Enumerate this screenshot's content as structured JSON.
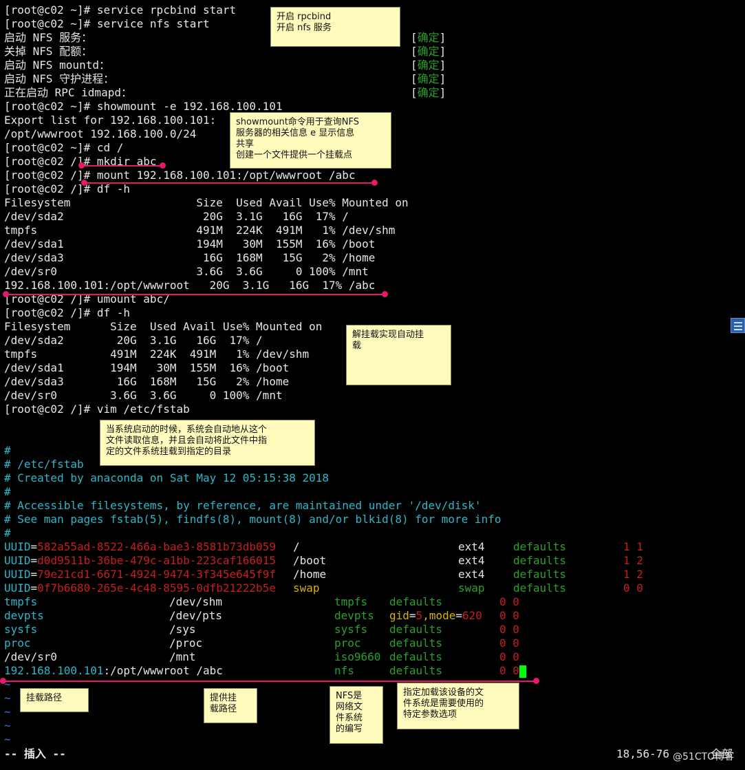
{
  "terminal": {
    "prompt_home": "[root@c02 ~]# ",
    "prompt_root": "[root@c02 /]# ",
    "cmd_rpcbind": "service rpcbind start",
    "cmd_nfs": "service nfs start",
    "svc": [
      {
        "label": "启动 NFS 服务：",
        "status": "确定"
      },
      {
        "label": "关掉 NFS 配额：",
        "status": "确定"
      },
      {
        "label": "启动 NFS mountd：",
        "status": "确定"
      },
      {
        "label": "启动 NFS 守护进程：",
        "status": "确定"
      },
      {
        "label": "正在启动 RPC idmapd：",
        "status": "确定"
      }
    ],
    "cmd_showmount": "showmount -e 192.168.100.101",
    "export_list": "Export list for 192.168.100.101:",
    "export_entry": "/opt/wwwroot 192.168.100.0/24",
    "cmd_cd": "cd /",
    "cmd_mkdir": "mkdir abc",
    "cmd_mount": "mount 192.168.100.101:/opt/wwwroot /abc",
    "cmd_df": "df -h",
    "df1": [
      "Filesystem                   Size  Used Avail Use% Mounted on",
      "/dev/sda2                     20G  3.1G   16G  17% /",
      "tmpfs                        491M  224K  491M   1% /dev/shm",
      "/dev/sda1                    194M   30M  155M  16% /boot",
      "/dev/sda3                     16G  168M   15G   2% /home",
      "/dev/sr0                     3.6G  3.6G     0 100% /mnt",
      "192.168.100.101:/opt/wwwroot   20G  3.1G   16G  17% /abc"
    ],
    "cmd_umount": "umount abc/",
    "df2": [
      "Filesystem      Size  Used Avail Use% Mounted on",
      "/dev/sda2        20G  3.1G   16G  17% /",
      "tmpfs           491M  224K  491M   1% /dev/shm",
      "/dev/sda1       194M   30M  155M  16% /boot",
      "/dev/sda3        16G  168M   15G   2% /home",
      "/dev/sr0        3.6G  3.6G     0 100% /mnt"
    ],
    "cmd_vim": "vim /etc/fstab",
    "fstab_comments": [
      "#",
      "# /etc/fstab",
      "# Created by anaconda on Sat May 12 05:15:38 2018",
      "#",
      "# Accessible filesystems, by reference, are maintained under '/dev/disk'",
      "# See man pages fstab(5), findfs(8), mount(8) and/or blkid(8) for more info",
      "#"
    ],
    "uuid_rows": [
      {
        "key": "UUID",
        "val": "582a55ad-8522-466a-bae3-8581b73db059",
        "mnt": "/",
        "fs": "ext4",
        "opt": "defaults",
        "nums": "1 1"
      },
      {
        "key": "UUID",
        "val": "d0d9511b-36be-479c-a1bb-223caf166015",
        "mnt": "/boot",
        "fs": "ext4",
        "opt": "defaults",
        "nums": "1 2"
      },
      {
        "key": "UUID",
        "val": "79e21cd1-6671-4924-9474-3f345e645f9f",
        "mnt": "/home",
        "fs": "ext4",
        "opt": "defaults",
        "nums": "1 2"
      },
      {
        "key": "UUID",
        "val": "0f7b6680-265e-4c48-8595-0dfb21222b5e",
        "mnt": "swap",
        "fs": "swap",
        "opt": "defaults",
        "nums": "0 0"
      }
    ],
    "dev_rows": [
      {
        "dev": "tmpfs",
        "mnt": "/dev/shm",
        "fs": "tmpfs",
        "opt": "defaults",
        "nums": "0 0"
      },
      {
        "dev": "devpts",
        "mnt": "/dev/pts",
        "fs": "devpts",
        "opt_a": "gid",
        "opt_b": "5",
        "opt_c": ",mode",
        "opt_d": "620",
        "nums": "0 0"
      },
      {
        "dev": "sysfs",
        "mnt": "/sys",
        "fs": "sysfs",
        "opt": "defaults",
        "nums": "0 0"
      },
      {
        "dev": "proc",
        "mnt": "/proc",
        "fs": "proc",
        "opt": "defaults",
        "nums": "0 0"
      },
      {
        "dev": "/dev/sr0",
        "mnt": "/mnt",
        "fs": "iso9660",
        "opt": "defaults",
        "nums": "0 0"
      }
    ],
    "nfs_row": {
      "ip": "192.168.100.101",
      "path": ":/opt/wwwroot /abc",
      "fs": "nfs",
      "opt": "defaults",
      "nums": "0 0"
    },
    "tilde": "~",
    "mode": "-- 插入 --",
    "position": "18,56-76",
    "position_tail": "全部"
  },
  "annotations": {
    "rpcbind_nfs": "开启 rpcbind\n开启 nfs 服务",
    "showmount": "showmount命令用于查询NFS\n服务器的相关信息 e 显示信息\n共享\n创建一个文件提供一个挂载点",
    "umount": "解挂载实现自动挂\n载",
    "fstab": "当系统启动的时候，系统会自动地从这个\n文件读取信息，并且会自动将此文件中指\n定的文件系统挂载到指定的目录",
    "mount_path": "挂载路径",
    "provide_path": "提供挂\n载路径",
    "nfs_abbr": "NFS是\n网络文\n件系统\n的编写",
    "options": "指定加载该设备的文\n件系统是需要使用的\n特定参数选项"
  },
  "watermark": "@51CTO博客",
  "colors": {
    "background": "#000000",
    "text": "#e6e6e6",
    "ok": "#2aa02a",
    "cyan": "#2cb7c8",
    "red": "#c81e1e",
    "note_bg": "#fffbbd",
    "marker": "#e8186a",
    "cursor": "#00ff00"
  }
}
